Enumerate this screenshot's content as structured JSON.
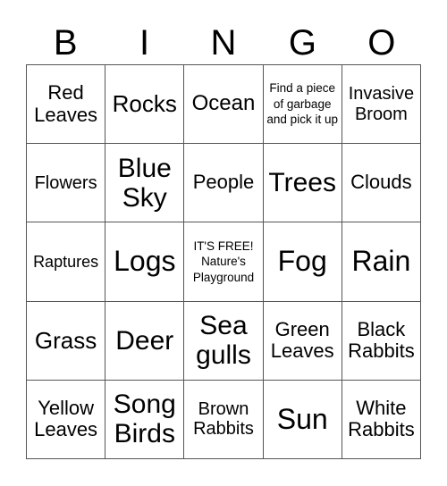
{
  "title_letters": [
    "B",
    "I",
    "N",
    "G",
    "O"
  ],
  "cells": [
    [
      "Red Leaves",
      "Rocks",
      "Ocean",
      "Find a piece of garbage and pick it up",
      "Invasive Broom"
    ],
    [
      "Flowers",
      "Blue Sky",
      "People",
      "Trees",
      "Clouds"
    ],
    [
      "Raptures",
      "Logs",
      "IT'S FREE! Nature's Playground",
      "Fog",
      "Rain"
    ],
    [
      "Grass",
      "Deer",
      "Sea gulls",
      "Green Leaves",
      "Black Rabbits"
    ],
    [
      "Yellow Leaves",
      "Song Birds",
      "Brown Rabbits",
      "Sun",
      "White Rabbits"
    ]
  ]
}
